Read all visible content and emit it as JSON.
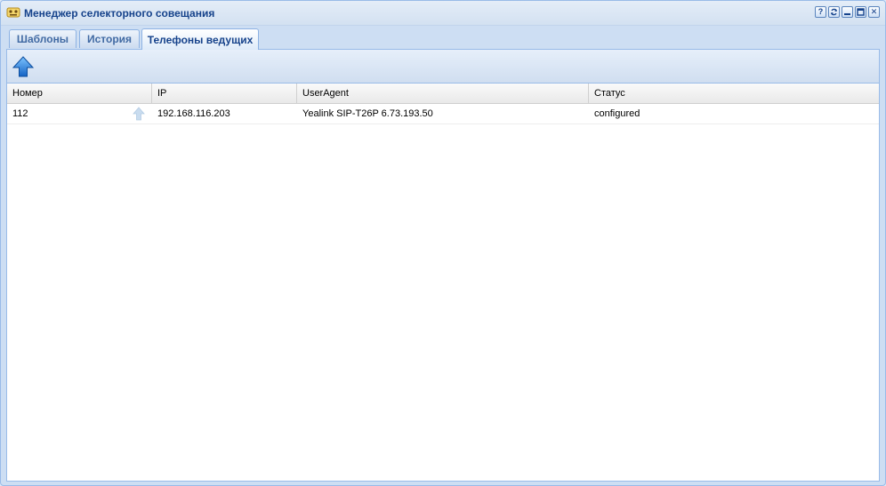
{
  "window": {
    "title": "Менеджер селекторного совещания",
    "tools": [
      "help",
      "refresh",
      "minimize",
      "maximize",
      "close"
    ],
    "tool_glyphs": {
      "help": "?",
      "close": "✕"
    }
  },
  "tabs": [
    {
      "label": "Шаблоны",
      "active": false
    },
    {
      "label": "История",
      "active": false
    },
    {
      "label": "Телефоны ведущих",
      "active": true
    }
  ],
  "toolbar": {
    "button_icon": "upload-arrow-icon"
  },
  "grid": {
    "columns": [
      "Номер",
      "IP",
      "UserAgent",
      "Статус"
    ],
    "rows": [
      {
        "number": "112",
        "ip": "192.168.116.203",
        "user_agent": "Yealink SIP-T26P 6.73.193.50",
        "status": "configured"
      }
    ]
  },
  "colors": {
    "title": "#15428b",
    "header_bg": "#dfe8f6",
    "border": "#99bbe8",
    "arrow": "#2f7fd6"
  }
}
